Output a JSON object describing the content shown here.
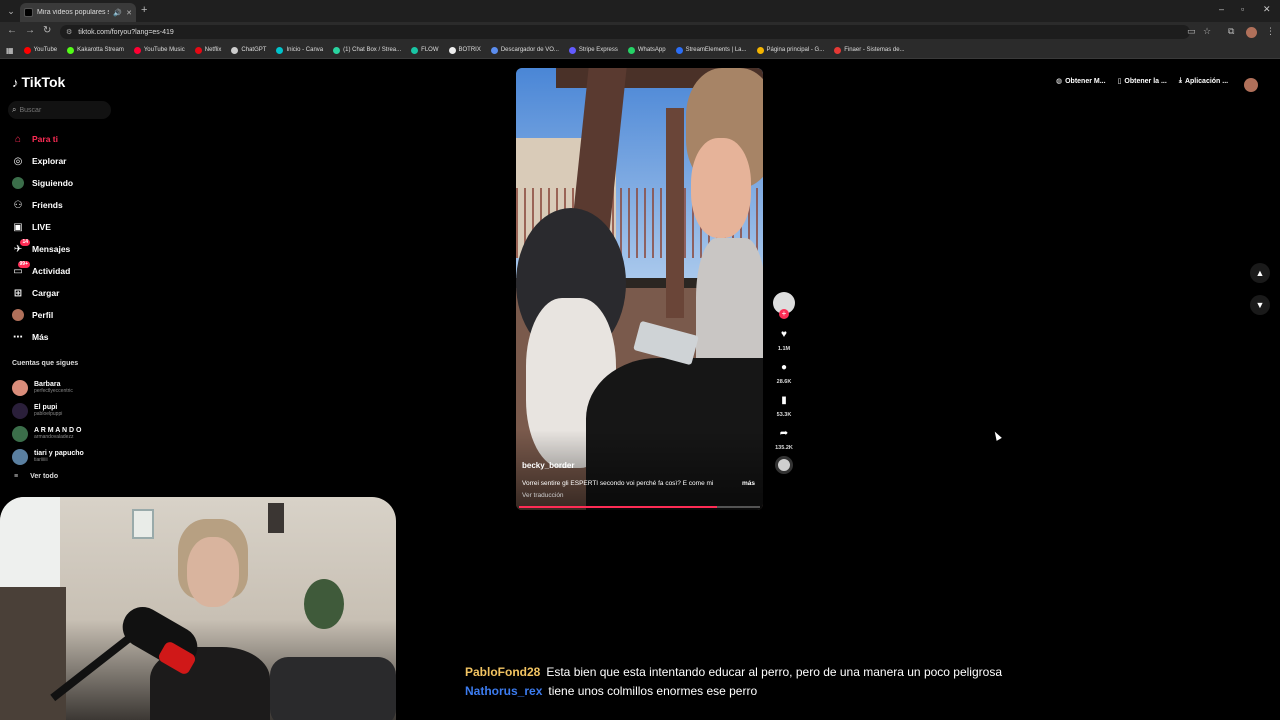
{
  "browser": {
    "tab_title": "Mira videos populares sel...",
    "url": "tiktok.com/foryou?lang=es-419",
    "bookmarks": [
      {
        "label": "YouTube",
        "color": "#ff0000"
      },
      {
        "label": "Kakarotta Stream",
        "color": "#53fc18"
      },
      {
        "label": "YouTube Music",
        "color": "#ff0033"
      },
      {
        "label": "Netflix",
        "color": "#e50914"
      },
      {
        "label": "ChatGPT",
        "color": "#cccccc"
      },
      {
        "label": "Inicio - Canva",
        "color": "#00c4cc"
      },
      {
        "label": "(1) Chat Box / Strea...",
        "color": "#2ad4a0"
      },
      {
        "label": "FLOW",
        "color": "#19c5a4"
      },
      {
        "label": "BOTRIX",
        "color": "#eeeeee"
      },
      {
        "label": "Descargador de VO...",
        "color": "#5b8def"
      },
      {
        "label": "Stripe Express",
        "color": "#635bff"
      },
      {
        "label": "WhatsApp",
        "color": "#25d366"
      },
      {
        "label": "StreamElements | La...",
        "color": "#2b6ef6"
      },
      {
        "label": "Página principal - G...",
        "color": "#f4b400"
      },
      {
        "label": "Finaer - Sistemas de...",
        "color": "#e53935"
      }
    ]
  },
  "sidebar": {
    "brand": "TikTok",
    "search_placeholder": "Buscar",
    "menu": [
      {
        "label": "Para ti",
        "icon": "home-icon",
        "active": true
      },
      {
        "label": "Explorar",
        "icon": "compass-icon"
      },
      {
        "label": "Siguiendo",
        "icon": "following-icon"
      },
      {
        "label": "Friends",
        "icon": "friends-icon"
      },
      {
        "label": "LIVE",
        "icon": "live-icon"
      },
      {
        "label": "Mensajes",
        "icon": "messages-icon",
        "badge": "14"
      },
      {
        "label": "Actividad",
        "icon": "activity-icon",
        "badge": "99+"
      },
      {
        "label": "Cargar",
        "icon": "upload-icon"
      },
      {
        "label": "Perfil",
        "icon": "profile-icon"
      },
      {
        "label": "Más",
        "icon": "more-icon"
      }
    ],
    "following_heading": "Cuentas que sigues",
    "following": [
      {
        "name": "Barbara",
        "handle": "perfectlyeccentric",
        "color": "#d98c7a"
      },
      {
        "name": "El pupi",
        "handle": "pabloelpuppi",
        "color": "#2a1f3a"
      },
      {
        "name": "A R M A N D O",
        "handle": "armandovaladezz",
        "color": "#3b6e4a"
      },
      {
        "name": "tiari y papucho",
        "handle": "tiariiiiii",
        "color": "#5a7fa0"
      }
    ],
    "see_all": "Ver todo"
  },
  "video": {
    "author": "becky_border",
    "caption": "Vorrei sentire gli ESPERTI secondo voi perché fa così? E come mi",
    "more": "más",
    "translate": "Ver traducción",
    "progress": 0.82
  },
  "actions": {
    "likes": "1.1M",
    "comments": "28.6K",
    "saves": "53.3K",
    "shares": "135.2K"
  },
  "topbar": {
    "get_coins": "Obtener M...",
    "get_app": "Obtener la ...",
    "app": "Aplicación ..."
  },
  "chat": [
    {
      "user": "PabloFond28",
      "color": "#f2c462",
      "text": "Esta bien que esta intentando educar al perro, pero de una manera un poco peligrosa"
    },
    {
      "user": "Nathorus_rex",
      "color": "#3c7cf0",
      "text": "tiene unos colmillos enormes ese perro"
    }
  ]
}
